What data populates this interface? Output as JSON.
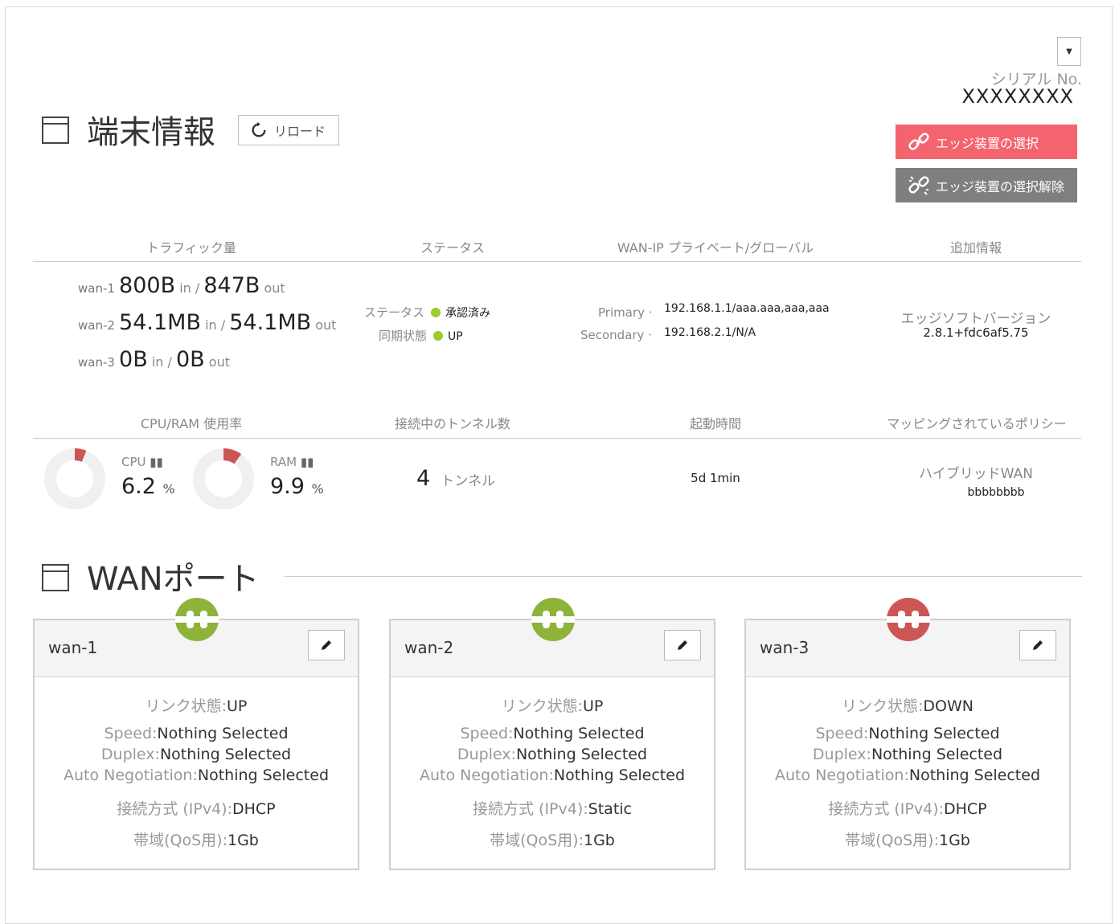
{
  "header": {
    "title": "端末情報",
    "reload_label": "リロード",
    "serial_label": "シリアル No.",
    "serial_value": "XXXXXXXX",
    "select_edge_label": "エッジ装置の選択",
    "deselect_edge_label": "エッジ装置の選択解除"
  },
  "info_headers": {
    "traffic": "トラフィック量",
    "status": "ステータス",
    "wan_ip": "WAN-IP プライベート/グローバル",
    "extra": "追加情報",
    "cpu_ram": "CPU/RAM 使用率",
    "tunnels": "接続中のトンネル数",
    "uptime": "起動時間",
    "policy": "マッピングされているポリシー"
  },
  "traffic": [
    {
      "name": "wan-1",
      "in": "800B",
      "in_unit": "in",
      "out": "847B",
      "out_unit": "out"
    },
    {
      "name": "wan-2",
      "in": "54.1MB",
      "in_unit": "in",
      "out": "54.1MB",
      "out_unit": "out"
    },
    {
      "name": "wan-3",
      "in": "0B",
      "in_unit": "in",
      "out": "0B",
      "out_unit": "out"
    }
  ],
  "status": {
    "status_label": "ステータス",
    "status_value": "承認済み",
    "sync_label": "同期状態",
    "sync_value": "UP",
    "dot_color": "#9ccc2e"
  },
  "wan_ip": {
    "primary_label": "Primary",
    "primary_value": "192.168.1.1/aaa.aaa,aaa,aaa",
    "secondary_label": "Secondary",
    "secondary_value": "192.168.2.1/N/A"
  },
  "extra": {
    "label": "エッジソフトバージョン",
    "value": "2.8.1+fdc6af5.75"
  },
  "usage": {
    "cpu_label": "CPU",
    "cpu_value": "6.2",
    "cpu_percent": 6.2,
    "ram_label": "RAM",
    "ram_value": "9.9",
    "ram_percent": 9.9,
    "unit": "%",
    "gauge_color": "#cc5555"
  },
  "tunnels": {
    "count": "4",
    "unit": "トンネル"
  },
  "uptime": {
    "value": "5d 1min"
  },
  "policy": {
    "name": "ハイブリッドWAN",
    "value": "bbbbbbbb"
  },
  "wan_section": {
    "title": "WANポート"
  },
  "wan_ports": [
    {
      "name": "wan-1",
      "link_label": "リンク状態:",
      "link_value": "UP",
      "plug_color": "#8db33a",
      "speed_label": "Speed:",
      "speed_value": "Nothing Selected",
      "duplex_label": "Duplex:",
      "duplex_value": "Nothing Selected",
      "autoneg_label": "Auto Negotiation:",
      "autoneg_value": "Nothing Selected",
      "conn_label": "接続方式 (IPv4):",
      "conn_value": "DHCP",
      "bw_label": "帯域(QoS用):",
      "bw_value": "1Gb"
    },
    {
      "name": "wan-2",
      "link_label": "リンク状態:",
      "link_value": "UP",
      "plug_color": "#8db33a",
      "speed_label": "Speed:",
      "speed_value": "Nothing Selected",
      "duplex_label": "Duplex:",
      "duplex_value": "Nothing Selected",
      "autoneg_label": "Auto Negotiation:",
      "autoneg_value": "Nothing Selected",
      "conn_label": "接続方式 (IPv4):",
      "conn_value": "Static",
      "bw_label": "帯域(QoS用):",
      "bw_value": "1Gb"
    },
    {
      "name": "wan-3",
      "link_label": "リンク状態:",
      "link_value": "DOWN",
      "plug_color": "#cc5555",
      "speed_label": "Speed:",
      "speed_value": "Nothing Selected",
      "duplex_label": "Duplex:",
      "duplex_value": "Nothing Selected",
      "autoneg_label": "Auto Negotiation:",
      "autoneg_value": "Nothing Selected",
      "conn_label": "接続方式 (IPv4):",
      "conn_value": "DHCP",
      "bw_label": "帯域(QoS用):",
      "bw_value": "1Gb"
    }
  ]
}
